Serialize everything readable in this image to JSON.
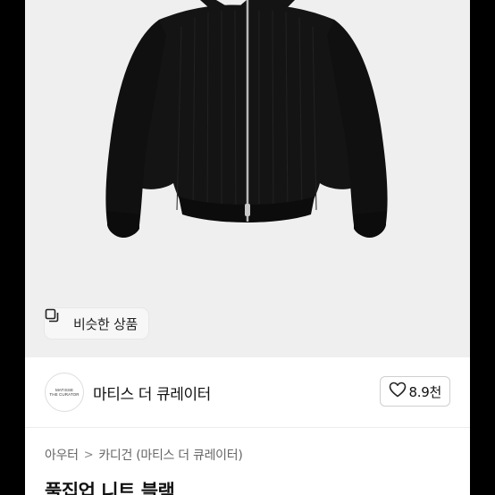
{
  "product": {
    "similar_button_label": "비슷한 상품",
    "similar_icon": "copy-icon",
    "title": "풀집업 니트 블랙"
  },
  "seller": {
    "logo_text_line1": "MATISSE",
    "logo_text_line2": "THE CURATOR",
    "name": "마티스 더 큐레이터",
    "favorite_count": "8.9천",
    "favorite_icon": "heart-icon"
  },
  "breadcrumb": {
    "items": [
      "아우터",
      "카디건 (마티스 더 큐레이터)"
    ],
    "separator": ">"
  },
  "colors": {
    "image_background": "#efefef",
    "garment": "#141414",
    "zipper": "#b9b9b9"
  }
}
